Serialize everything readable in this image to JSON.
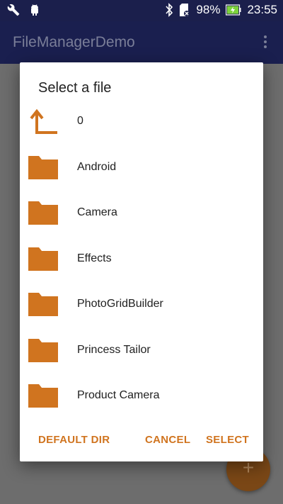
{
  "status_bar": {
    "icons_left": [
      "wrench-icon",
      "android-icon"
    ],
    "icons_right": [
      "bluetooth-icon",
      "sd-card-icon",
      "battery-charging-icon"
    ],
    "battery": "98%",
    "time": "23:55"
  },
  "app_bar": {
    "title": "FileManagerDemo"
  },
  "dialog": {
    "title": "Select a file",
    "items": [
      {
        "name": "0",
        "icon": "parent-directory-icon"
      },
      {
        "name": "Android",
        "icon": "folder-icon"
      },
      {
        "name": "Camera",
        "icon": "folder-icon"
      },
      {
        "name": "Effects",
        "icon": "folder-icon"
      },
      {
        "name": "PhotoGridBuilder",
        "icon": "folder-icon"
      },
      {
        "name": "Princess Tailor",
        "icon": "folder-icon"
      },
      {
        "name": "Product Camera",
        "icon": "folder-icon"
      }
    ],
    "buttons": {
      "default_dir": "DEFAULT DIR",
      "cancel": "CANCEL",
      "select": "SELECT"
    }
  },
  "fab": {
    "icon": "plus-icon",
    "symbol": "+"
  },
  "colors": {
    "accent": "#d0741f",
    "app_bar": "#1a1f4f",
    "status_bar": "#1b1f4c",
    "dialog_bg": "#ffffff",
    "scrim": "#6d6d6d"
  }
}
